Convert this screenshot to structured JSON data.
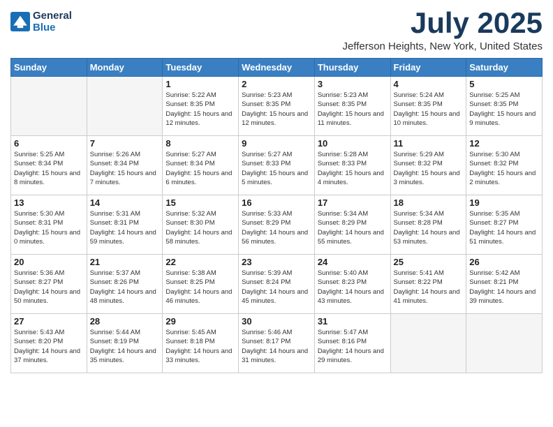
{
  "header": {
    "logo_line1": "General",
    "logo_line2": "Blue",
    "month_title": "July 2025",
    "location": "Jefferson Heights, New York, United States"
  },
  "weekdays": [
    "Sunday",
    "Monday",
    "Tuesday",
    "Wednesday",
    "Thursday",
    "Friday",
    "Saturday"
  ],
  "weeks": [
    [
      {
        "day": null,
        "sunrise": null,
        "sunset": null,
        "daylight": null
      },
      {
        "day": null,
        "sunrise": null,
        "sunset": null,
        "daylight": null
      },
      {
        "day": "1",
        "sunrise": "5:22 AM",
        "sunset": "8:35 PM",
        "daylight": "15 hours and 12 minutes."
      },
      {
        "day": "2",
        "sunrise": "5:23 AM",
        "sunset": "8:35 PM",
        "daylight": "15 hours and 12 minutes."
      },
      {
        "day": "3",
        "sunrise": "5:23 AM",
        "sunset": "8:35 PM",
        "daylight": "15 hours and 11 minutes."
      },
      {
        "day": "4",
        "sunrise": "5:24 AM",
        "sunset": "8:35 PM",
        "daylight": "15 hours and 10 minutes."
      },
      {
        "day": "5",
        "sunrise": "5:25 AM",
        "sunset": "8:35 PM",
        "daylight": "15 hours and 9 minutes."
      }
    ],
    [
      {
        "day": "6",
        "sunrise": "5:25 AM",
        "sunset": "8:34 PM",
        "daylight": "15 hours and 8 minutes."
      },
      {
        "day": "7",
        "sunrise": "5:26 AM",
        "sunset": "8:34 PM",
        "daylight": "15 hours and 7 minutes."
      },
      {
        "day": "8",
        "sunrise": "5:27 AM",
        "sunset": "8:34 PM",
        "daylight": "15 hours and 6 minutes."
      },
      {
        "day": "9",
        "sunrise": "5:27 AM",
        "sunset": "8:33 PM",
        "daylight": "15 hours and 5 minutes."
      },
      {
        "day": "10",
        "sunrise": "5:28 AM",
        "sunset": "8:33 PM",
        "daylight": "15 hours and 4 minutes."
      },
      {
        "day": "11",
        "sunrise": "5:29 AM",
        "sunset": "8:32 PM",
        "daylight": "15 hours and 3 minutes."
      },
      {
        "day": "12",
        "sunrise": "5:30 AM",
        "sunset": "8:32 PM",
        "daylight": "15 hours and 2 minutes."
      }
    ],
    [
      {
        "day": "13",
        "sunrise": "5:30 AM",
        "sunset": "8:31 PM",
        "daylight": "15 hours and 0 minutes."
      },
      {
        "day": "14",
        "sunrise": "5:31 AM",
        "sunset": "8:31 PM",
        "daylight": "14 hours and 59 minutes."
      },
      {
        "day": "15",
        "sunrise": "5:32 AM",
        "sunset": "8:30 PM",
        "daylight": "14 hours and 58 minutes."
      },
      {
        "day": "16",
        "sunrise": "5:33 AM",
        "sunset": "8:29 PM",
        "daylight": "14 hours and 56 minutes."
      },
      {
        "day": "17",
        "sunrise": "5:34 AM",
        "sunset": "8:29 PM",
        "daylight": "14 hours and 55 minutes."
      },
      {
        "day": "18",
        "sunrise": "5:34 AM",
        "sunset": "8:28 PM",
        "daylight": "14 hours and 53 minutes."
      },
      {
        "day": "19",
        "sunrise": "5:35 AM",
        "sunset": "8:27 PM",
        "daylight": "14 hours and 51 minutes."
      }
    ],
    [
      {
        "day": "20",
        "sunrise": "5:36 AM",
        "sunset": "8:27 PM",
        "daylight": "14 hours and 50 minutes."
      },
      {
        "day": "21",
        "sunrise": "5:37 AM",
        "sunset": "8:26 PM",
        "daylight": "14 hours and 48 minutes."
      },
      {
        "day": "22",
        "sunrise": "5:38 AM",
        "sunset": "8:25 PM",
        "daylight": "14 hours and 46 minutes."
      },
      {
        "day": "23",
        "sunrise": "5:39 AM",
        "sunset": "8:24 PM",
        "daylight": "14 hours and 45 minutes."
      },
      {
        "day": "24",
        "sunrise": "5:40 AM",
        "sunset": "8:23 PM",
        "daylight": "14 hours and 43 minutes."
      },
      {
        "day": "25",
        "sunrise": "5:41 AM",
        "sunset": "8:22 PM",
        "daylight": "14 hours and 41 minutes."
      },
      {
        "day": "26",
        "sunrise": "5:42 AM",
        "sunset": "8:21 PM",
        "daylight": "14 hours and 39 minutes."
      }
    ],
    [
      {
        "day": "27",
        "sunrise": "5:43 AM",
        "sunset": "8:20 PM",
        "daylight": "14 hours and 37 minutes."
      },
      {
        "day": "28",
        "sunrise": "5:44 AM",
        "sunset": "8:19 PM",
        "daylight": "14 hours and 35 minutes."
      },
      {
        "day": "29",
        "sunrise": "5:45 AM",
        "sunset": "8:18 PM",
        "daylight": "14 hours and 33 minutes."
      },
      {
        "day": "30",
        "sunrise": "5:46 AM",
        "sunset": "8:17 PM",
        "daylight": "14 hours and 31 minutes."
      },
      {
        "day": "31",
        "sunrise": "5:47 AM",
        "sunset": "8:16 PM",
        "daylight": "14 hours and 29 minutes."
      },
      {
        "day": null,
        "sunrise": null,
        "sunset": null,
        "daylight": null
      },
      {
        "day": null,
        "sunrise": null,
        "sunset": null,
        "daylight": null
      }
    ]
  ]
}
